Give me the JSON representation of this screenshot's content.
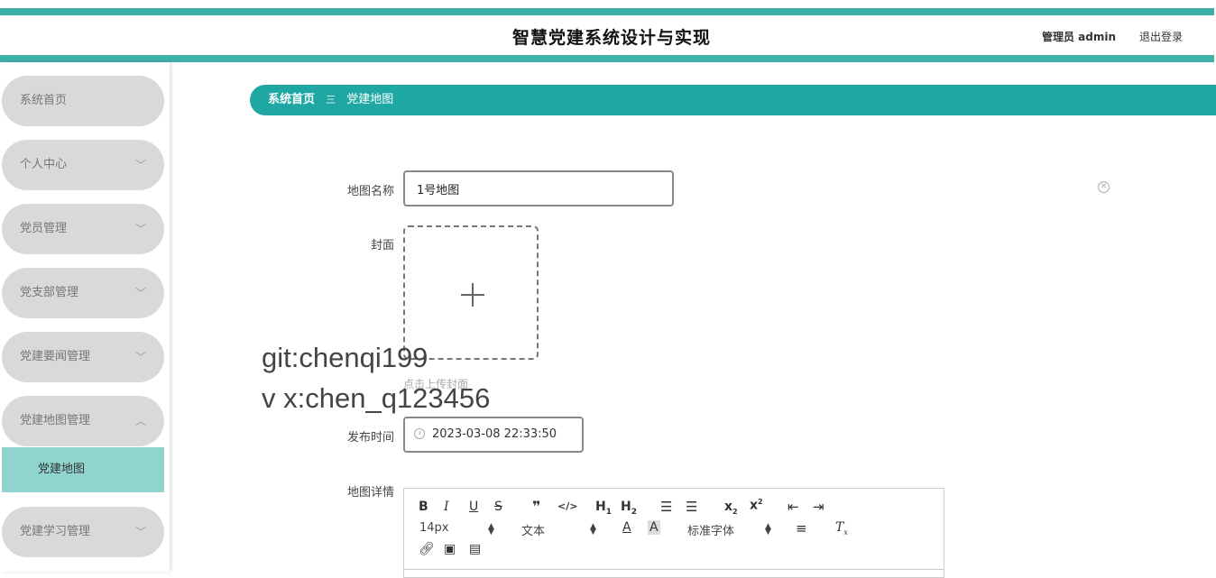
{
  "header": {
    "title": "智慧党建系统设计与实现",
    "admin_label": "管理员 admin",
    "logout_label": "退出登录",
    "accent_color": "#3fafaa"
  },
  "sidebar": {
    "items": [
      {
        "label": "系统首页"
      },
      {
        "label": "个人中心",
        "chevron": "chevron-down-icon"
      },
      {
        "label": "党员管理",
        "chevron": "chevron-down-icon"
      },
      {
        "label": "党支部管理",
        "chevron": "chevron-down-icon"
      },
      {
        "label": "党建要闻管理",
        "chevron": "chevron-down-icon"
      },
      {
        "label": "党建地图管理",
        "chevron": "chevron-up-icon"
      },
      {
        "label": "党建学习管理",
        "chevron": "chevron-down-icon"
      }
    ],
    "submenu": {
      "label": "党建地图",
      "active_color": "#8fd4cf"
    }
  },
  "breadcrumb": {
    "home": "系统首页",
    "separator": "三",
    "current": "党建地图",
    "color": "#1fa8a3"
  },
  "form": {
    "map_name": {
      "label": "地图名称",
      "value": "1号地图"
    },
    "cover": {
      "label": "封面",
      "hint": "点击上传封面"
    },
    "publish_time": {
      "label": "发布时间",
      "value": "2023-03-08 22:33:50"
    },
    "detail": {
      "label": "地图详情"
    }
  },
  "watermark": {
    "line1": "git:chenqi199",
    "line2": "v x:chen_q123456"
  },
  "editor_toolbar": {
    "font_size": "14px",
    "block_format": "文本",
    "font_family": "标准字体",
    "buttons_row1": [
      "bold-icon",
      "italic-icon",
      "underline-icon",
      "strikethrough-icon",
      "blockquote-icon",
      "code-icon",
      "h1-icon",
      "h2-icon",
      "ordered-list-icon",
      "bullet-list-icon",
      "subscript-icon",
      "superscript-icon",
      "outdent-icon",
      "indent-icon"
    ],
    "buttons_row2": [
      "font-color-icon",
      "background-color-icon",
      "align-icon",
      "clear-format-icon"
    ],
    "buttons_row3": [
      "link-icon",
      "image-icon",
      "video-icon"
    ]
  }
}
